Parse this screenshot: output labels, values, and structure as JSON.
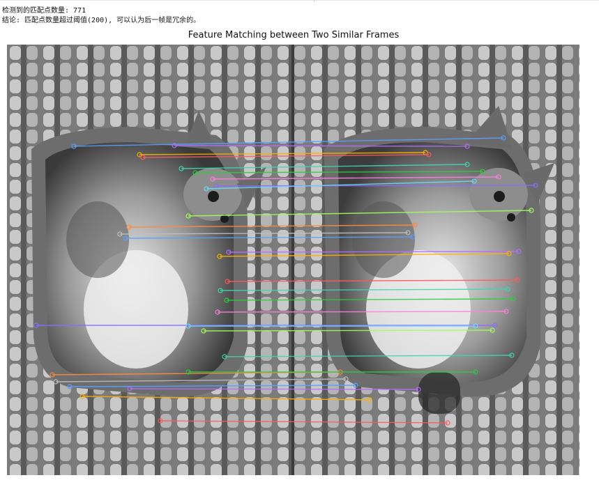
{
  "console": {
    "line1": "检测到的匹配点数量: 771",
    "line2": "结论: 匹配点数量超过阈值(200), 可以认为后一帧是冗余的。"
  },
  "figure": {
    "title": "Feature Matching between Two Similar Frames",
    "left_image": "kitten-frame-1",
    "right_image": "kitten-frame-2",
    "match_colors": [
      "#5aa0ff",
      "#b76cff",
      "#ffb000",
      "#ff5a5a",
      "#3fd6b0",
      "#2ecc40",
      "#ff7fe0",
      "#8a6cff",
      "#6ad9ff",
      "#a0ff5a",
      "#ff8a3d",
      "#c0c0c0"
    ]
  }
}
